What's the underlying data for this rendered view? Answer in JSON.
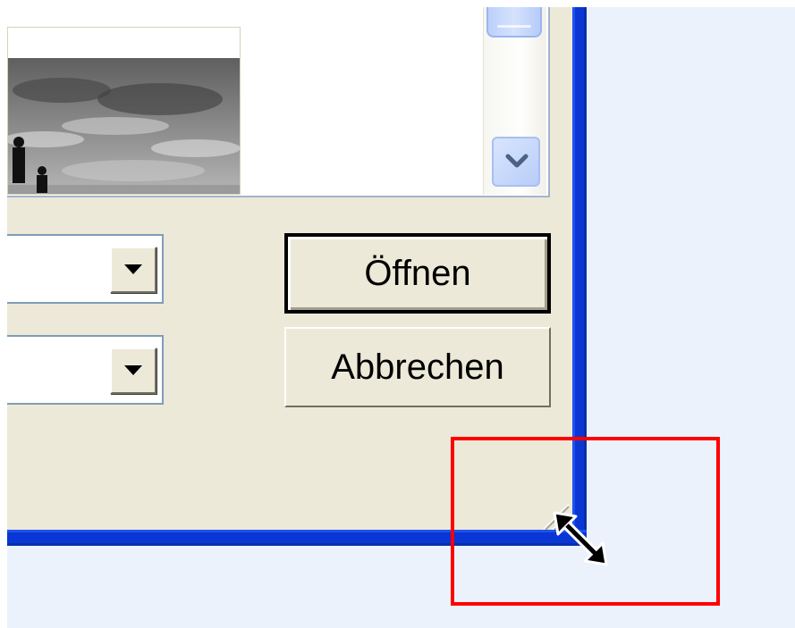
{
  "dialog": {
    "buttons": {
      "open_label": "Öffnen",
      "cancel_label": "Abbrechen"
    },
    "file_type_combo": {
      "value": ""
    },
    "encoding_combo": {
      "value": ""
    },
    "preview": {
      "image": "cloudy-sky-photo-with-figures"
    }
  },
  "overlay": {
    "highlight_color": "#ff0000",
    "cursor": "resize-diagonal-cursor"
  },
  "colors": {
    "window_frame": "#0a36d4",
    "dialog_bg": "#ece9d8",
    "desktop_bg": "#ebf2fc"
  }
}
